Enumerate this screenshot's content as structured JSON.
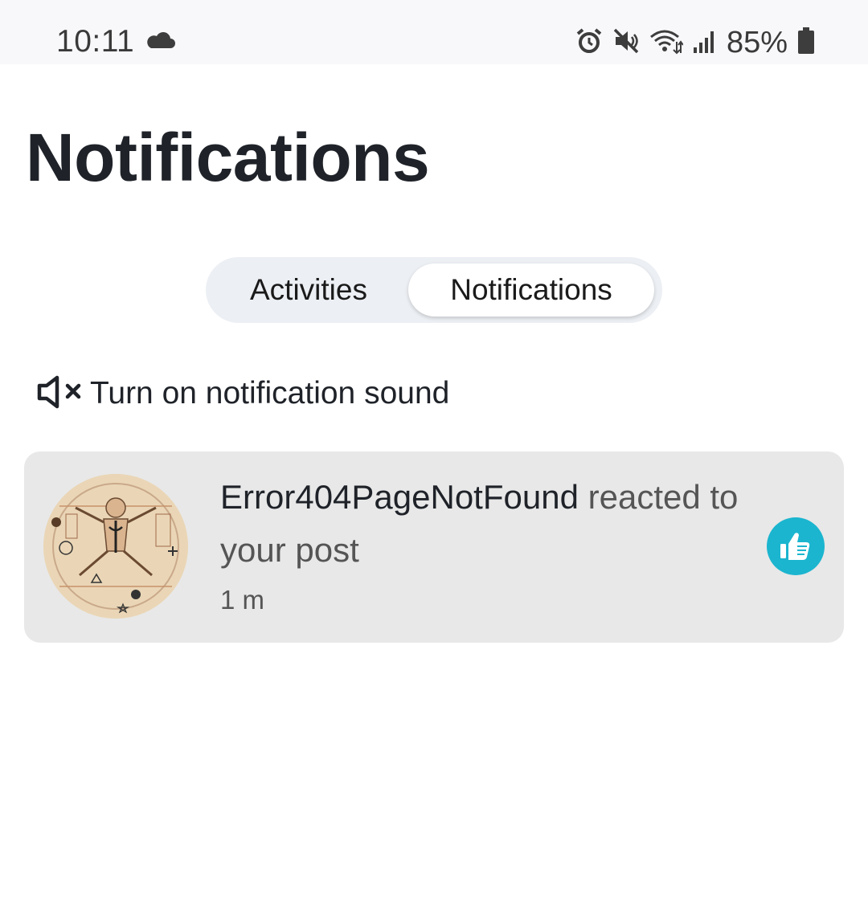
{
  "status_bar": {
    "time": "10:11",
    "battery": "85%",
    "icons": [
      "cloud-icon",
      "alarm-icon",
      "mute-icon",
      "wifi-icon",
      "signal-icon",
      "battery-icon"
    ]
  },
  "page": {
    "title": "Notifications"
  },
  "tabs": {
    "activities_label": "Activities",
    "notifications_label": "Notifications",
    "selected": "Notifications"
  },
  "sound_toggle": {
    "label": "Turn on notification sound",
    "icon": "speaker-muted-icon"
  },
  "notifications": [
    {
      "user": "Error404PageNotFound",
      "message": " reacted to your post",
      "time": "1 m",
      "reaction_icon": "thumbs-up-icon"
    }
  ],
  "colors": {
    "accent": "#1bb5cf",
    "card_background": "#e8e8e8",
    "segment_background": "#eceff3",
    "status_bar_background": "#f8f8fb"
  }
}
